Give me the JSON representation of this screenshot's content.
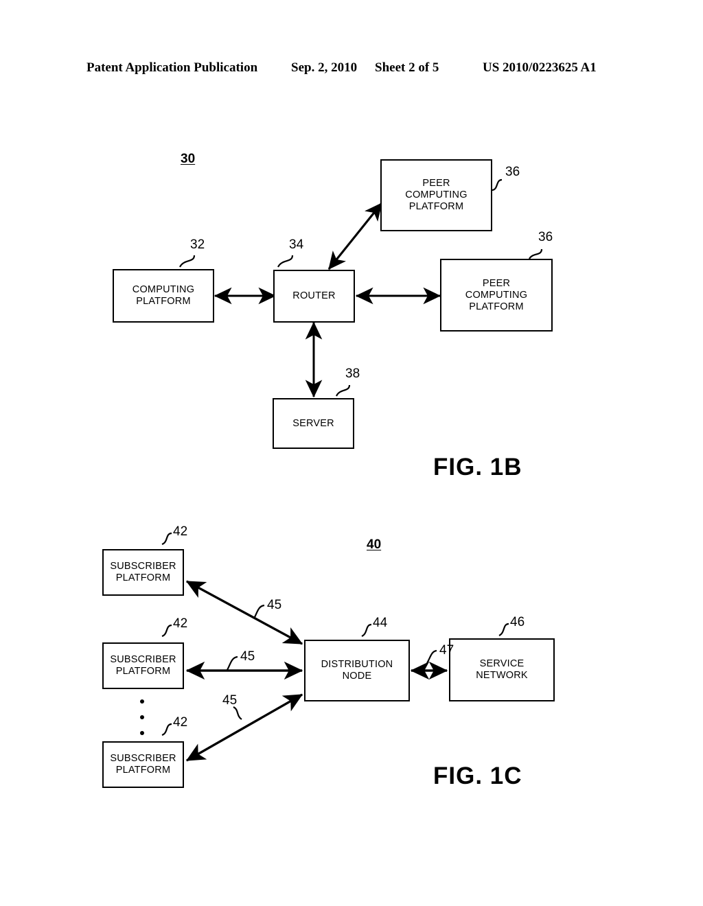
{
  "header": {
    "publication": "Patent Application Publication",
    "date": "Sep. 2, 2010",
    "sheet": "Sheet 2 of 5",
    "patent_number": "US 2010/0223625 A1"
  },
  "figures": [
    {
      "caption": "FIG. 1B",
      "system_ref": "30",
      "nodes": [
        {
          "id": "computing-platform",
          "label": "COMPUTING\nPLATFORM",
          "ref": "32"
        },
        {
          "id": "router",
          "label": "ROUTER",
          "ref": "34"
        },
        {
          "id": "peer-computing-platform-top",
          "label": "PEER\nCOMPUTING\nPLATFORM",
          "ref": "36"
        },
        {
          "id": "peer-computing-platform-right",
          "label": "PEER\nCOMPUTING\nPLATFORM",
          "ref": "36"
        },
        {
          "id": "server",
          "label": "SERVER",
          "ref": "38"
        }
      ],
      "connections": [
        {
          "from": "computing-platform",
          "to": "router",
          "style": "double-arrow"
        },
        {
          "from": "router",
          "to": "peer-computing-platform-top",
          "style": "double-arrow"
        },
        {
          "from": "router",
          "to": "peer-computing-platform-right",
          "style": "double-arrow"
        },
        {
          "from": "router",
          "to": "server",
          "style": "double-arrow"
        }
      ]
    },
    {
      "caption": "FIG. 1C",
      "system_ref": "40",
      "nodes": [
        {
          "id": "subscriber-platform-1",
          "label": "SUBSCRIBER\nPLATFORM",
          "ref": "42"
        },
        {
          "id": "subscriber-platform-2",
          "label": "SUBSCRIBER\nPLATFORM",
          "ref": "42"
        },
        {
          "id": "subscriber-platform-3",
          "label": "SUBSCRIBER\nPLATFORM",
          "ref": "42"
        },
        {
          "id": "distribution-node",
          "label": "DISTRIBUTION\nNODE",
          "ref": "44"
        },
        {
          "id": "service-network",
          "label": "SERVICE\nNETWORK",
          "ref": "46"
        }
      ],
      "connections": [
        {
          "from": "subscriber-platform-1",
          "to": "distribution-node",
          "ref": "45",
          "style": "double-arrow"
        },
        {
          "from": "subscriber-platform-2",
          "to": "distribution-node",
          "ref": "45",
          "style": "double-arrow"
        },
        {
          "from": "subscriber-platform-3",
          "to": "distribution-node",
          "ref": "45",
          "style": "double-arrow"
        },
        {
          "from": "distribution-node",
          "to": "service-network",
          "ref": "47",
          "style": "double-arrow"
        }
      ],
      "ellipsis": "vertical-three-dots"
    }
  ],
  "colors": {
    "ink": "#000000",
    "paper": "#ffffff"
  }
}
